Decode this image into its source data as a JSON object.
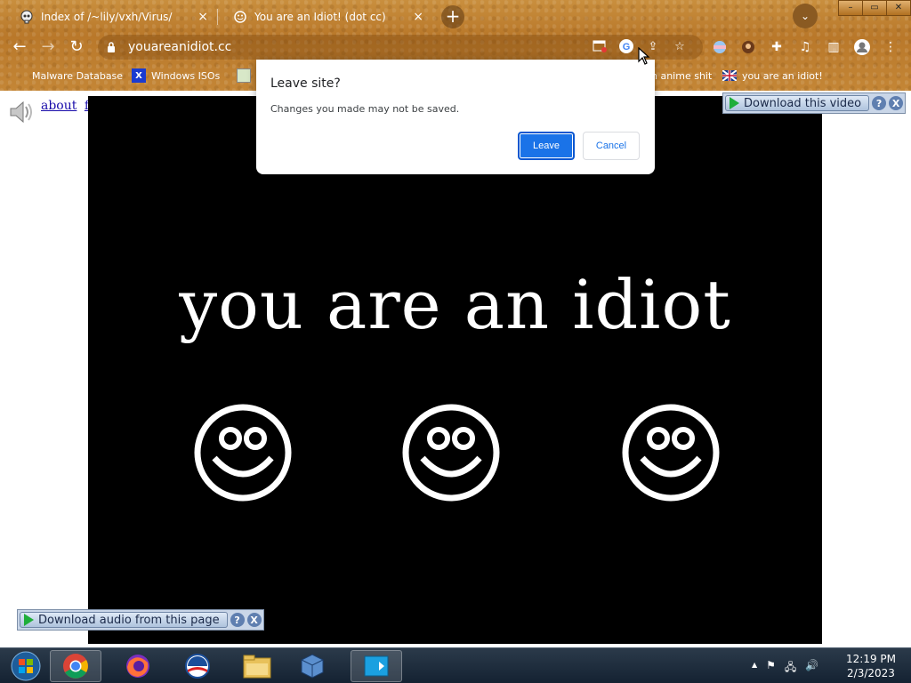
{
  "tabs": [
    {
      "title": "Index of /~lily/vxh/Virus/",
      "close": "×"
    },
    {
      "title": "You are an Idiot! (dot cc)",
      "close": "×"
    }
  ],
  "new_tab": "+",
  "window_controls": [
    "–",
    "▭",
    "✕"
  ],
  "address": {
    "url": "youareanidiot.cc"
  },
  "bookmarks": [
    {
      "label": "Malware Database"
    },
    {
      "label": "Windows ISOs"
    },
    {
      "label": "n anime shit"
    },
    {
      "label": "you are an idiot!"
    }
  ],
  "page": {
    "links": [
      "about",
      "flash"
    ],
    "headline": "you are an idiot",
    "download_video": "Download this video",
    "download_audio": "Download audio from this page",
    "help": "?",
    "close": "X"
  },
  "dialog": {
    "title": "Leave site?",
    "message": "Changes you made may not be saved.",
    "leave": "Leave",
    "cancel": "Cancel"
  },
  "taskbar": {
    "time": "12:19 PM",
    "date": "2/3/2023",
    "tray_arrow": "▲"
  },
  "colors": {
    "accent": "#1a73e8",
    "chrome_frame": "#c48636",
    "video_bg": "#000000"
  }
}
